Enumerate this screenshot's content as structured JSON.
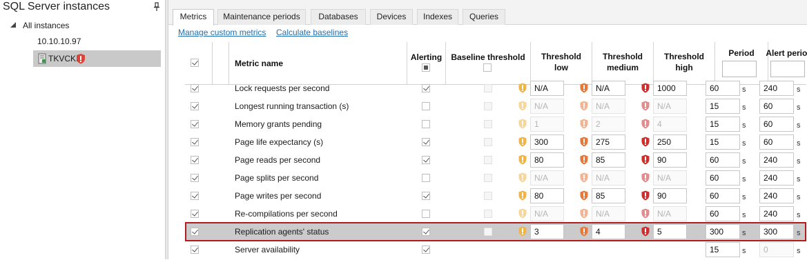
{
  "left_panel": {
    "title": "SQL Server instances",
    "tree": {
      "root_label": "All instances",
      "children": [
        {
          "label": "10.10.10.97"
        },
        {
          "label": "TKVCKI"
        }
      ]
    }
  },
  "tabs": [
    "Metrics",
    "Maintenance periods",
    "Databases",
    "Devices",
    "Indexes",
    "Queries"
  ],
  "active_tab": "Metrics",
  "links": {
    "manage_custom_metrics": "Manage custom metrics",
    "calculate_baselines": "Calculate baselines"
  },
  "columns": {
    "metric_name": "Metric name",
    "alerting": "Alerting",
    "baseline_threshold": "Baseline threshold",
    "threshold_low": [
      "Threshold",
      "low"
    ],
    "threshold_medium": [
      "Threshold",
      "medium"
    ],
    "threshold_high": [
      "Threshold",
      "high"
    ],
    "period": "Period",
    "alert_period": "Alert period"
  },
  "unit_label": "s",
  "rows": [
    {
      "name": "Lock requests per second",
      "alerting": true,
      "low": "N/A",
      "medium": "N/A",
      "high": "1000",
      "enabled": true,
      "period": "60",
      "alert_period": "240"
    },
    {
      "name": "Longest running transaction (s)",
      "alerting": false,
      "low": "N/A",
      "medium": "N/A",
      "high": "N/A",
      "enabled": false,
      "period": "15",
      "alert_period": "60"
    },
    {
      "name": "Memory grants pending",
      "alerting": false,
      "low": "1",
      "medium": "2",
      "high": "4",
      "enabled": false,
      "period": "15",
      "alert_period": "60"
    },
    {
      "name": "Page life expectancy (s)",
      "alerting": true,
      "low": "300",
      "medium": "275",
      "high": "250",
      "enabled": true,
      "period": "15",
      "alert_period": "60"
    },
    {
      "name": "Page reads per second",
      "alerting": true,
      "low": "80",
      "medium": "85",
      "high": "90",
      "enabled": true,
      "period": "60",
      "alert_period": "240"
    },
    {
      "name": "Page splits per second",
      "alerting": false,
      "low": "N/A",
      "medium": "N/A",
      "high": "N/A",
      "enabled": false,
      "period": "60",
      "alert_period": "240"
    },
    {
      "name": "Page writes per second",
      "alerting": true,
      "low": "80",
      "medium": "85",
      "high": "90",
      "enabled": true,
      "period": "60",
      "alert_period": "240"
    },
    {
      "name": "Re-compilations per second",
      "alerting": false,
      "low": "N/A",
      "medium": "N/A",
      "high": "N/A",
      "enabled": false,
      "period": "60",
      "alert_period": "240"
    },
    {
      "name": "Replication agents' status",
      "alerting": true,
      "low": "3",
      "medium": "4",
      "high": "5",
      "enabled": true,
      "period": "300",
      "alert_period": "300",
      "selected": true
    },
    {
      "name": "Server availability",
      "alerting": true,
      "low": "",
      "medium": "",
      "high": "",
      "enabled": false,
      "period": "15",
      "alert_period": "0",
      "alert_period_disabled": true,
      "no_thresholds": true
    }
  ],
  "colors": {
    "warning_low": "#f0b54a",
    "warning_medium": "#e8773a",
    "warning_high": "#cf2e2e",
    "link": "#1e6fb6",
    "selection_border": "#b11b1b"
  }
}
